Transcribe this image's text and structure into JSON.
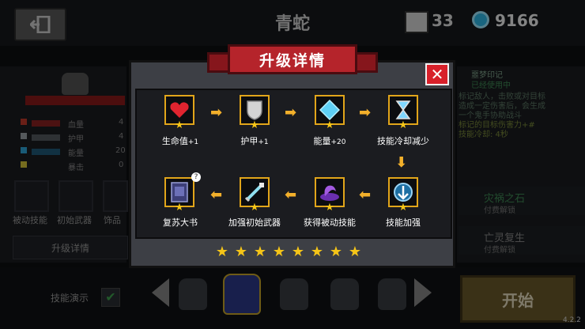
{
  "header": {
    "back_icon": "exit-icon",
    "hero_name": "青蛇",
    "energy_value": "33",
    "gem_value": "9166"
  },
  "left_panel": {
    "stats": [
      {
        "label": "血量",
        "value": "4",
        "color": "#c0392b"
      },
      {
        "label": "护甲",
        "value": "4",
        "color": "#9aa0a6"
      },
      {
        "label": "能量",
        "value": "20",
        "color": "#2fa6d9"
      },
      {
        "label": "暴击",
        "value": "0",
        "color": "#d6c53a"
      }
    ],
    "skills": [
      "被动技能",
      "初始武器",
      "饰品"
    ],
    "upgrade_details_label": "升级详情"
  },
  "right_panel": {
    "title": "噩梦印记",
    "status": "已经使用中",
    "desc_lines": [
      "标记敌人，击败或对目标",
      "造成一定伤害后，会生成",
      "一个鬼手协助战斗",
      "标记的目标伤害力+#",
      "技能冷却: 4秒"
    ],
    "rows": [
      {
        "title": "灾祸之石",
        "sub": "付费解锁"
      },
      {
        "title": "亡灵复生",
        "sub": "付费解锁"
      }
    ]
  },
  "bottom": {
    "demo_label": "技能演示",
    "start_label": "开始",
    "version": "4.2.2"
  },
  "modal": {
    "title": "升级详情",
    "close_icon": "close-icon",
    "nodes": [
      {
        "label": "生命值",
        "suffix": "+1",
        "icon": "heart-icon"
      },
      {
        "label": "护甲",
        "suffix": "+1",
        "icon": "shield-icon"
      },
      {
        "label": "能量",
        "suffix": "+20",
        "icon": "diamond-icon"
      },
      {
        "label": "技能冷却减少",
        "suffix": "",
        "icon": "hourglass-icon"
      },
      {
        "label": "技能加强",
        "suffix": "",
        "icon": "skill-boost-icon"
      },
      {
        "label": "获得被动技能",
        "suffix": "",
        "icon": "hand-icon"
      },
      {
        "label": "加强初始武器",
        "suffix": "",
        "icon": "sword-icon"
      },
      {
        "label": "复苏大书",
        "suffix": "",
        "icon": "book-icon"
      }
    ],
    "stars_count": 8
  },
  "colors": {
    "accent_gold": "#e1a51a",
    "ribbon_red": "#b5242b",
    "close_red": "#d8202a"
  }
}
